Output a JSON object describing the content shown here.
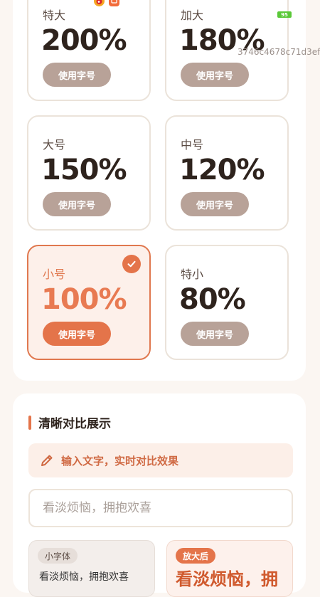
{
  "status": {
    "icons": [
      "weibo-icon",
      "app-notification-icon"
    ],
    "battery": "95",
    "hash": "3746c4678c71d3ef"
  },
  "font_sizes": {
    "button_label": "使用字号",
    "options": [
      {
        "name": "特大",
        "percent": "200%",
        "selected": false
      },
      {
        "name": "加大",
        "percent": "180%",
        "selected": false
      },
      {
        "name": "大号",
        "percent": "150%",
        "selected": false
      },
      {
        "name": "中号",
        "percent": "120%",
        "selected": false
      },
      {
        "name": "小号",
        "percent": "100%",
        "selected": true
      },
      {
        "name": "特小",
        "percent": "80%",
        "selected": false
      }
    ]
  },
  "compare": {
    "title": "清晰对比展示",
    "hint": "输入文字，实时对比效果",
    "input_placeholder": "看淡烦恼，拥抱欢喜",
    "small_tag": "小字体",
    "large_tag": "放大后",
    "small_sample": "看淡烦恼，拥抱欢喜",
    "large_sample": "看淡烦恼，拥"
  },
  "colors": {
    "accent": "#e4744a",
    "button_gray": "#b8a298",
    "background": "#fbf6f2"
  }
}
